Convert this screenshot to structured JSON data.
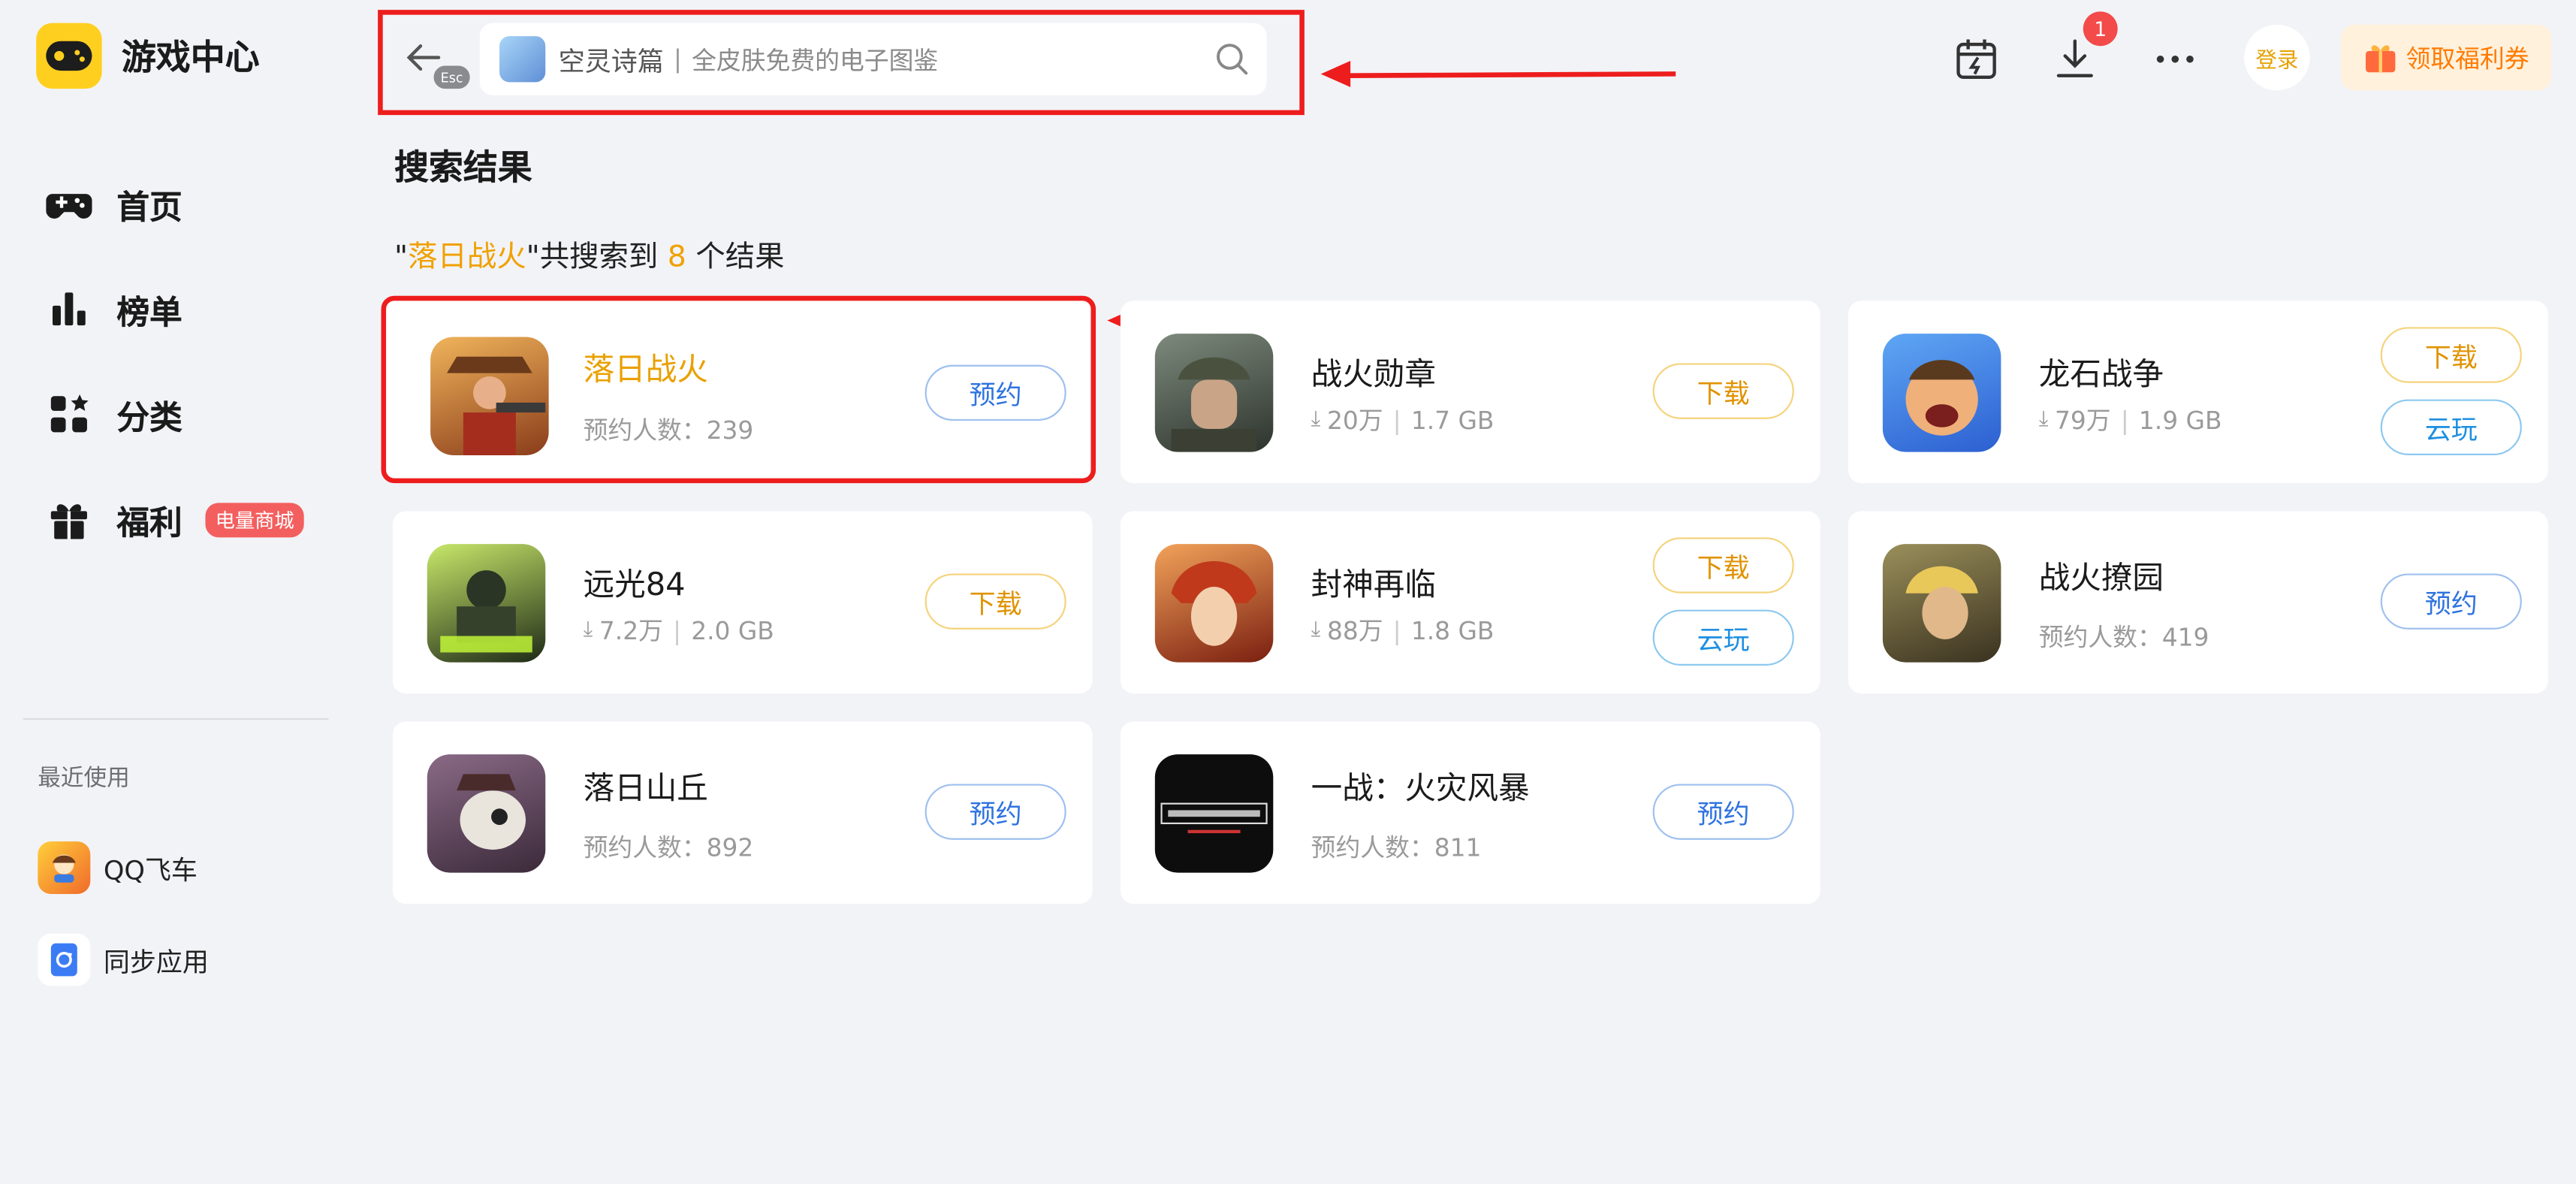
{
  "app": {
    "title": "游戏中心"
  },
  "sidebar": {
    "items": [
      {
        "label": "首页",
        "icon": "gamepad-icon"
      },
      {
        "label": "榜单",
        "icon": "chart-icon"
      },
      {
        "label": "分类",
        "icon": "category-icon"
      },
      {
        "label": "福利",
        "icon": "gift-icon",
        "badge": "电量商城"
      }
    ],
    "recent_title": "最近使用",
    "recent": [
      {
        "label": "QQ飞车",
        "icon": "qq-speed-icon"
      },
      {
        "label": "同步应用",
        "icon": "sync-app-icon"
      }
    ]
  },
  "topbar": {
    "esc": "Esc",
    "search": {
      "title": "空灵诗篇",
      "separator": "|",
      "subtitle": "全皮肤免费的电子图鉴"
    },
    "download_badge": "1",
    "login": "登录",
    "welfare": "领取福利券"
  },
  "main": {
    "section_title": "搜索结果",
    "result": {
      "q_open": "\"",
      "query": "落日战火",
      "q_close": "\"",
      "prefix": "共搜索到 ",
      "count": "8",
      "suffix": " 个结果"
    },
    "cards": [
      {
        "title": "落日战火",
        "sub": "预约人数：239",
        "buttons": [
          "预约"
        ],
        "title_color": "#e9a000"
      },
      {
        "title": "战火勋章",
        "downloads": "20万",
        "size": "1.7 GB",
        "buttons": [
          "下载"
        ]
      },
      {
        "title": "龙石战争",
        "downloads": "79万",
        "size": "1.9 GB",
        "buttons": [
          "下载",
          "云玩"
        ]
      },
      {
        "title": "远光84",
        "downloads": "7.2万",
        "size": "2.0 GB",
        "buttons": [
          "下载"
        ]
      },
      {
        "title": "封神再临",
        "downloads": "88万",
        "size": "1.8 GB",
        "buttons": [
          "下载",
          "云玩"
        ]
      },
      {
        "title": "战火撩园",
        "sub": "预约人数：419",
        "buttons": [
          "预约"
        ]
      },
      {
        "title": "落日山丘",
        "sub": "预约人数：892",
        "buttons": [
          "预约"
        ]
      },
      {
        "title": "一战：火灾风暴",
        "sub": "预约人数：811",
        "buttons": [
          "预约"
        ]
      }
    ]
  },
  "colors": {
    "accent": "#f0a100",
    "highlight_border": "#ee1d1d",
    "reserve": "#2f73e0",
    "download": "#e09200",
    "cloud": "#1f8fe0"
  }
}
